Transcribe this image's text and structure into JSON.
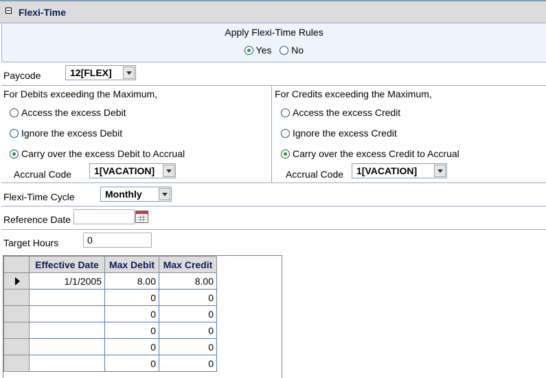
{
  "panel": {
    "title": "Flexi-Time"
  },
  "apply": {
    "label": "Apply Flexi-Time Rules",
    "yes": "Yes",
    "no": "No",
    "selected": "Yes"
  },
  "paycode": {
    "label": "Paycode",
    "value": "12[FLEX]"
  },
  "debits": {
    "heading": "For Debits exceeding the Maximum,",
    "options": [
      "Access the excess Debit",
      "Ignore the excess Debit",
      "Carry over the excess Debit to Accrual"
    ],
    "selected_index": 2,
    "accrual_label": "Accrual Code",
    "accrual_value": "1[VACATION]"
  },
  "credits": {
    "heading": "For Credits exceeding the Maximum,",
    "options": [
      "Access the excess Credit",
      "Ignore the excess Credit",
      "Carry over the excess Credit to Accrual"
    ],
    "selected_index": 2,
    "accrual_label": "Accrual Code",
    "accrual_value": "1[VACATION]"
  },
  "cycle": {
    "label": "Flexi-Time Cycle",
    "value": "Monthly"
  },
  "reference_date": {
    "label": "Reference Date",
    "value": ""
  },
  "target_hours": {
    "label": "Target Hours",
    "value": "0"
  },
  "grid": {
    "columns": [
      "Effective Date",
      "Max Debit",
      "Max Credit"
    ],
    "rows": [
      [
        "1/1/2005",
        "8.00",
        "8.00"
      ],
      [
        "",
        "0",
        "0"
      ],
      [
        "",
        "0",
        "0"
      ],
      [
        "",
        "0",
        "0"
      ],
      [
        "",
        "0",
        "0"
      ],
      [
        "",
        "0",
        "0"
      ]
    ],
    "current_row": 0
  },
  "colors": {
    "header_bg": "#dcdcdc",
    "title_text": "#0a1b5c",
    "radio_dot": "#21a121",
    "grid_line": "#4a7ac9"
  }
}
